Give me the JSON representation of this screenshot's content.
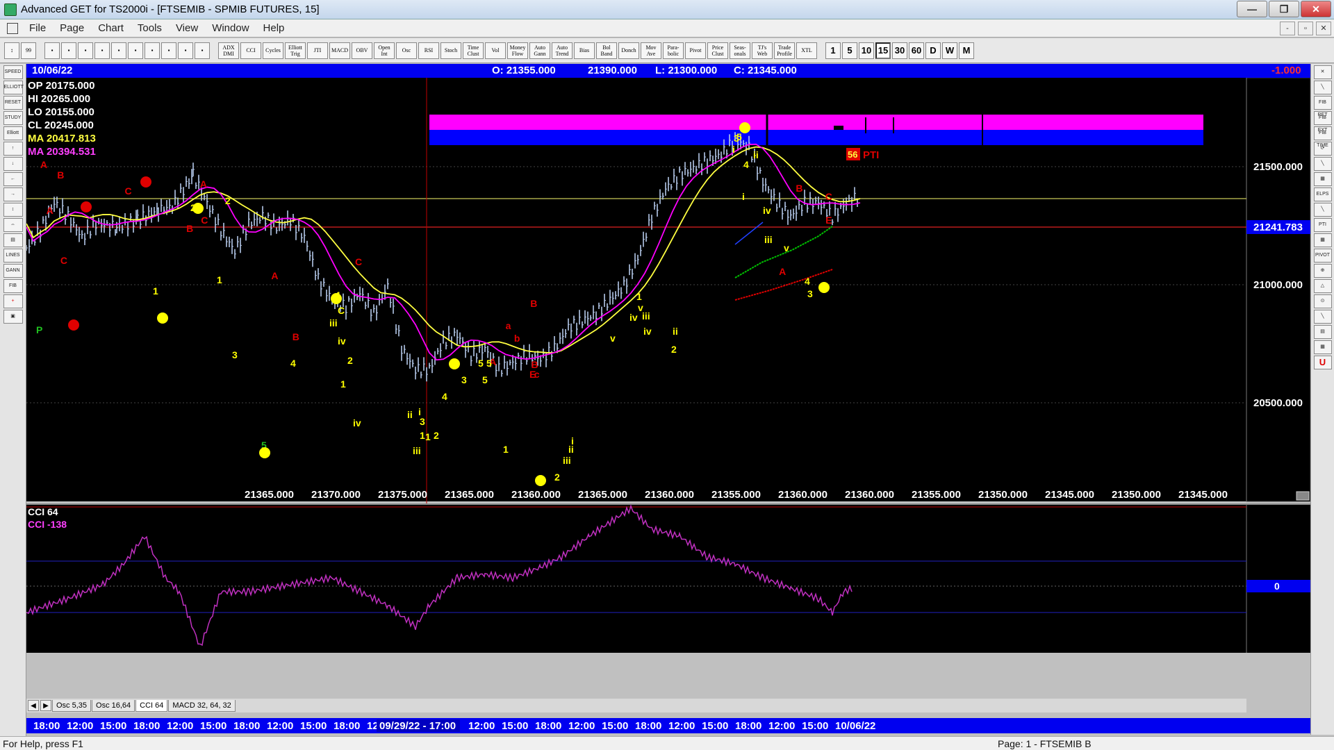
{
  "window": {
    "title": "Advanced GET for TS2000i - [FTSEMIB - SPMIB FUTURES, 15]",
    "buttons": [
      "—",
      "❐",
      "✕"
    ]
  },
  "menu": {
    "items": [
      "File",
      "Page",
      "Chart",
      "Tools",
      "View",
      "Window",
      "Help"
    ],
    "mdi_buttons": [
      "-",
      "▫",
      "✕"
    ]
  },
  "toolbar": {
    "studies": [
      "ADX DMI",
      "CCI",
      "Cycles",
      "Elliott Trig",
      "JTI",
      "MACD",
      "OBV",
      "Open Int",
      "Osc",
      "RSI",
      "Stoch",
      "Time Clust",
      "Vol",
      "Money Flow",
      "Auto Gann",
      "Auto Trend",
      "Bias",
      "Bol Band",
      "Donch",
      "Mov Ave",
      "Para-bolic",
      "Pivot",
      "Price Clust",
      "Seas-onals",
      "TJ's Web",
      "Trade Profile",
      "XTL"
    ],
    "intervals": [
      "1",
      "5",
      "10",
      "15",
      "30",
      "60",
      "D",
      "W",
      "M"
    ],
    "active_interval": "15"
  },
  "left_tools": [
    "SPEED",
    "ELLIOTT",
    "RESET",
    "STUDY",
    "Elliott",
    "↑",
    "↓",
    "←",
    "→",
    "↕",
    "⇔",
    "▤",
    "LINES",
    "GANN",
    "FIB",
    "+",
    "▣"
  ],
  "right_tools": [
    "✕",
    "╲",
    "FIB RET",
    "FIB EXT",
    "FIB TIME",
    "⟳",
    "╲",
    "▦",
    "ELPS",
    "╲",
    "PTI",
    "▦",
    "PIVOT",
    "⊕",
    "△",
    "⊙",
    "╲",
    "▤",
    "▦",
    "U"
  ],
  "chart_header": {
    "date": "10/06/22",
    "open": "O: 21355.000",
    "high": "21390.000",
    "low": "L:  21300.000",
    "close": "C:  21345.000",
    "change": "-1.000"
  },
  "info_panel": {
    "op": "OP  20175.000",
    "hi": "HI   20265.000",
    "lo": "LO  20155.000",
    "cl": "CL  20245.000",
    "ma1": "MA  20417.813",
    "ma2": "MA  20394.531"
  },
  "price_axis": {
    "ticks": [
      "21500.000",
      "21000.000",
      "20500.000"
    ],
    "current": "21241.783",
    "current_color": "#0000f0"
  },
  "cci_panel": {
    "label": "CCI 64",
    "value": "CCI  -138",
    "zero_label": "0"
  },
  "pti": {
    "value": "56",
    "label": "PTI"
  },
  "bottom_price_row": [
    "21365.000",
    "21370.000",
    "21375.000",
    "21365.000",
    "21360.000",
    "21365.000",
    "21360.000",
    "21355.000",
    "21360.000",
    "21360.000",
    "21355.000",
    "21350.000",
    "21345.000",
    "21350.000",
    "21345.000"
  ],
  "osc_tabs": [
    "Osc 5,35",
    "Osc 16,64",
    "CCI 64",
    "MACD 32, 64, 32"
  ],
  "active_osc_tab": "CCI 64",
  "time_axis": [
    "18:00",
    "12:00",
    "15:00",
    "18:00",
    "12:00",
    "15:00",
    "18:00",
    "12:00",
    "15:00",
    "18:00",
    "12",
    "09/29/22 - 17:00",
    "12:00",
    "15:00",
    "18:00",
    "12:00",
    "15:00",
    "18:00",
    "12:00",
    "15:00",
    "18:00",
    "12:00",
    "15:00",
    "10/06/22"
  ],
  "wave_labels": {
    "red": [
      "A",
      "B",
      "A",
      "C",
      "C",
      "C",
      "A",
      "B",
      "A",
      "B",
      "C",
      "B",
      "a",
      "b",
      "A",
      "B",
      "c",
      "A",
      "B",
      "C",
      "E",
      "E"
    ],
    "yellow": [
      "2",
      "1",
      "2",
      "1",
      "4",
      "C",
      "iii",
      "iv",
      "2",
      "1",
      "3",
      "4",
      "3",
      "5",
      "4",
      "5",
      "1",
      "ii",
      "i",
      "iv",
      "iii",
      "1",
      "2",
      "3",
      "5",
      "1",
      "2",
      "i",
      "ii",
      "iii",
      "v",
      "iv",
      "2",
      "1",
      "v",
      "iii",
      "iv",
      "ii",
      "i",
      "3",
      "5",
      "4",
      "ii",
      "i",
      "iv",
      "iii",
      "v",
      "4",
      "3"
    ],
    "green": [
      "P",
      "5"
    ]
  },
  "status": {
    "help": "For Help, press F1",
    "page": "Page: 1 - FTSEMIB B"
  },
  "colors": {
    "background": "#000000",
    "header_blue": "#0000f0",
    "price_bars": "#b4c8ea",
    "ma_yellow": "#ffff40",
    "ma_magenta": "#ff00ff",
    "wave_red": "#e00000",
    "wave_yellow": "#ffff00",
    "cci_line": "#c030c0"
  }
}
